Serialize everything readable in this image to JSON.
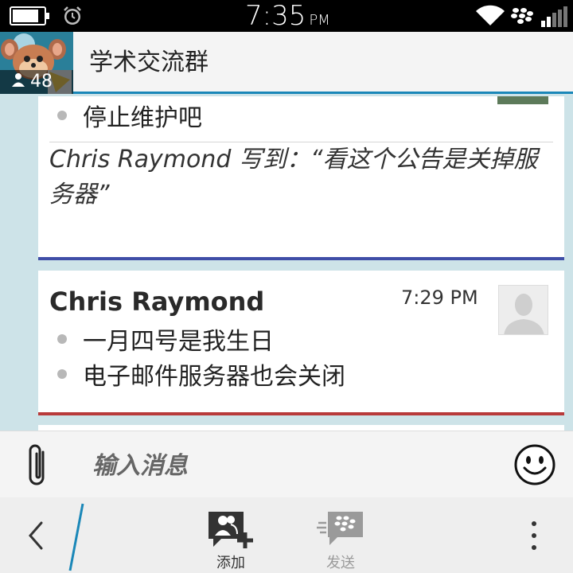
{
  "status_bar": {
    "time": "7:35",
    "ampm": "PM",
    "battery_level": 0.85,
    "icons": [
      "battery-icon",
      "alarm-icon",
      "wifi-icon",
      "blackberry-icon",
      "signal-icon"
    ]
  },
  "header": {
    "title": "学术交流群",
    "member_count": "48"
  },
  "messages": [
    {
      "bullets": [
        "停止维护吧"
      ],
      "quote": "Chris Raymond 写到：“看这个公告是关掉服务器”",
      "accent": "#3f4ea7"
    },
    {
      "sender": "Chris Raymond",
      "time": "7:29 PM",
      "bullets": [
        "一月四号是我生日",
        "电子邮件服务器也会关闭"
      ],
      "accent": "#b83a3a"
    }
  ],
  "composer": {
    "placeholder": "输入消息"
  },
  "action_bar": {
    "add_label": "添加",
    "send_label": "发送"
  },
  "colors": {
    "accent_blue": "#1a87b8",
    "background": "#cde3e8"
  }
}
